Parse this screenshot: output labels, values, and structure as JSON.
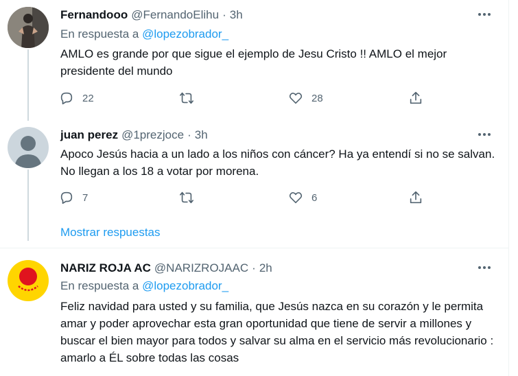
{
  "tweets": [
    {
      "name": "Fernandooo",
      "handle": "@FernandoElihu",
      "time": "3h",
      "reply_prefix": "En respuesta a",
      "reply_mention": "@lopezobrador_",
      "text": "AMLO es grande por que sigue el ejemplo de Jesu Cristo !! AMLO el mejor presidente del mundo",
      "replies": "22",
      "retweets": "",
      "likes": "28"
    },
    {
      "name": "juan perez",
      "handle": "@1prezjoce",
      "time": "3h",
      "text": "Apoco Jesús hacia a un lado a los niños con cáncer? Ha ya entendí si no se salvan. No llegan a los 18 a votar por morena.",
      "replies": "7",
      "retweets": "",
      "likes": "6"
    },
    {
      "name": "NARIZ ROJA AC",
      "handle": "@NARIZROJAAC",
      "time": "2h",
      "reply_prefix": "En respuesta a",
      "reply_mention": "@lopezobrador_",
      "text": "Feliz navidad para usted y su familia, que Jesús nazca en su corazón y le permita amar y poder aprovechar esta gran oportunidad que tiene de servir a millones y buscar el bien mayor para todos y salvar su alma en el servicio más revolucionario : amarlo a ÉL sobre todas las cosas"
    }
  ],
  "show_replies_label": "Mostrar respuestas",
  "separator": "·",
  "colors": {
    "accent": "#1d9bf0",
    "secondary_text": "#536471",
    "primary_text": "#0f1419",
    "thread_line": "#cfd9de",
    "nariz_roja_avatar_bg": "#ffd500",
    "nariz_roja_nose": "#e0141e"
  },
  "icons": [
    "more-icon",
    "reply-icon",
    "retweet-icon",
    "like-icon",
    "share-icon"
  ]
}
